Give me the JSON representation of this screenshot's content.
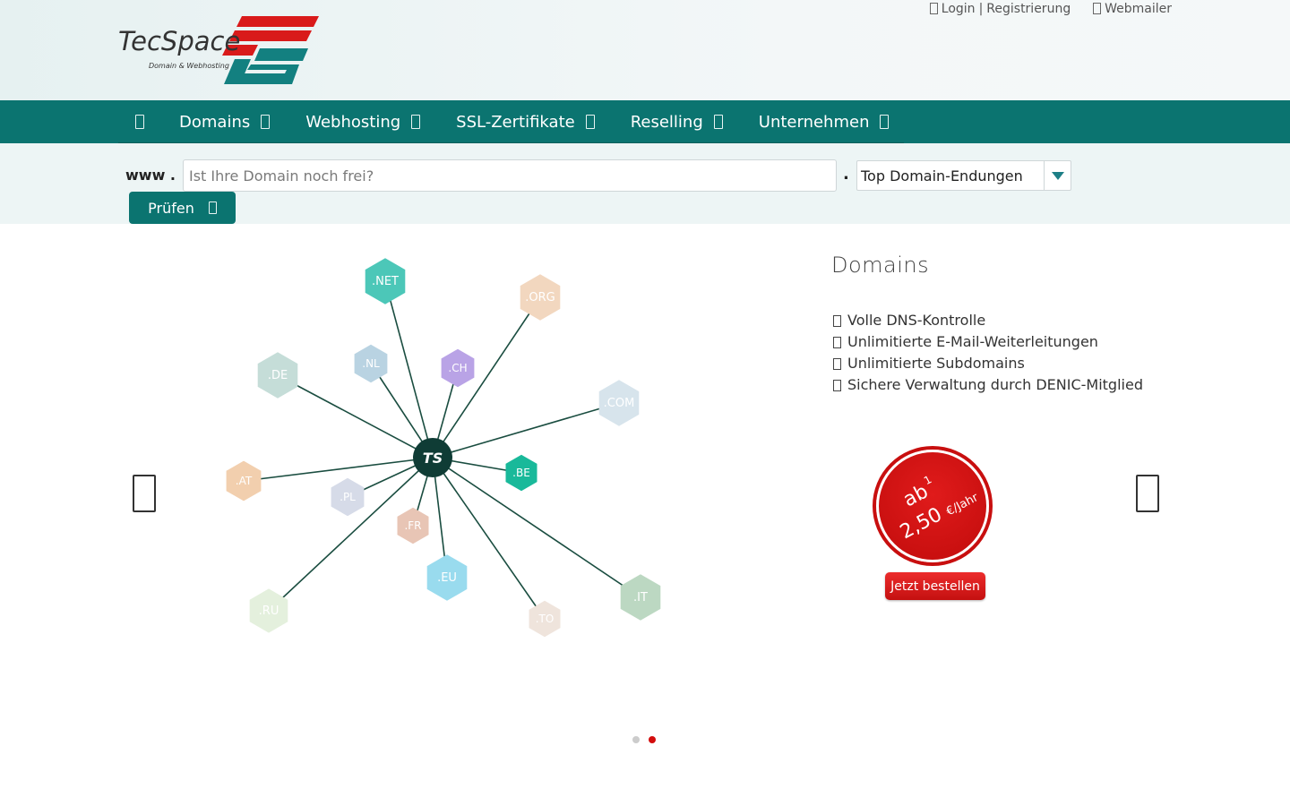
{
  "header": {
    "logo_name": "TecSpace",
    "logo_tagline": "Domain & Webhosting",
    "logo_mark": "TS",
    "login_label": "Login",
    "separator": "|",
    "register_label": "Registrierung",
    "webmailer_label": "Webmailer"
  },
  "nav": {
    "items": [
      {
        "label": "Domains"
      },
      {
        "label": "Webhosting"
      },
      {
        "label": "SSL-Zertifikate"
      },
      {
        "label": "Reselling"
      },
      {
        "label": "Unternehmen"
      }
    ]
  },
  "search": {
    "prefix": "www .",
    "placeholder": "Ist Ihre Domain noch frei?",
    "dot": ".",
    "tld_selected": "Top Domain-Endungen",
    "submit_label": "Prüfen"
  },
  "slide": {
    "title": "Domains",
    "features": [
      "Volle DNS-Kontrolle",
      "Unlimitierte E-Mail-Weiterleitungen",
      "Unlimitierte Subdomains",
      "Sichere Verwaltung durch DENIC-Mitglied"
    ],
    "price_prefix": "ab",
    "price_footnote": "1",
    "price_value": "2,50",
    "price_unit": "€/Jahr",
    "order_label": "Jetzt bestellen",
    "hub_label": "TS",
    "tlds": [
      ".NET",
      ".ORG",
      ".DE",
      ".NL",
      ".CH",
      ".COM",
      ".BE",
      ".AT",
      ".PL",
      ".FR",
      ".EU",
      ".RU",
      ".TO",
      ".IT"
    ],
    "tld_colors": [
      "#4cc7b8",
      "#f2d7bf",
      "#c5ddd8",
      "#b9d3e2",
      "#b9a3e6",
      "#d7e4ec",
      "#19b99a",
      "#f2cfae",
      "#d6dbe8",
      "#e8c5b5",
      "#99dbee",
      "#e4f0dd",
      "#efe4dc",
      "#bcd8c2"
    ]
  },
  "carousel": {
    "active_index": 1,
    "count": 2
  },
  "colors": {
    "brand_teal": "#0b7470",
    "brand_red": "#d30d0d"
  }
}
